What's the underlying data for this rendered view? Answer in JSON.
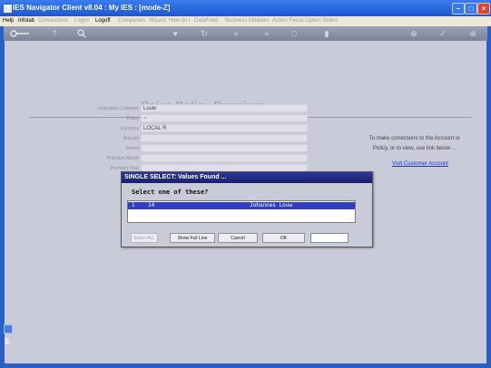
{
  "window": {
    "title": "IES Navigator Client v8.04 : My IES :     [mode-Z]",
    "controls": [
      "minimize-icon",
      "maximize-icon",
      "close-icon"
    ]
  },
  "menu": {
    "items": [
      "Help",
      "Infolab",
      "Connections",
      "Logon",
      "Logoff",
      "Companies",
      "Wizard",
      "How do I",
      "DataField",
      "Business Modules",
      "Action Focus",
      "Option Select"
    ]
  },
  "toolbar": {
    "icons": [
      "key-icon",
      "help-icon",
      "search-icon",
      "heart-icon",
      "refresh-icon",
      "back-icon",
      "forward-icon",
      "document-icon",
      "options-icon",
      "add-icon",
      "check-icon",
      "close-icon"
    ]
  },
  "form": {
    "title": "Raise Policy Premium",
    "fields": [
      {
        "label": "Insurance Customer",
        "value": "Louw"
      },
      {
        "label": "Policy",
        "value": "~"
      },
      {
        "label": "Currency",
        "value": "LOCAL R"
      },
      {
        "label": "Amount",
        "value": ""
      },
      {
        "label": "Period",
        "value": ""
      },
      {
        "label": "Premium Month",
        "value": ""
      },
      {
        "label": "Premium Year",
        "value": ""
      }
    ],
    "note_line1": "To make corrections to the Account or",
    "note_line2": "Policy, or to view, use link below ...",
    "link_label": "Visit Customer Account"
  },
  "dialog": {
    "title": "SINGLE SELECT: Values Found ...",
    "prompt": "Select one of these?",
    "rows": [
      {
        "index": "1",
        "code": "14",
        "name": "Johannes Louw"
      }
    ],
    "buttons": {
      "select_all": "Select ALL",
      "show_full_line": "Show Full Line",
      "cancel": "Cancel",
      "ok": "OK"
    },
    "input_value": ""
  },
  "colors": {
    "window_frame": "#2a5ec8",
    "content_bg": "#c9cbd8",
    "dialog_title": "#1e2577",
    "selection": "#2f3ec4",
    "link": "#1c33c7"
  }
}
